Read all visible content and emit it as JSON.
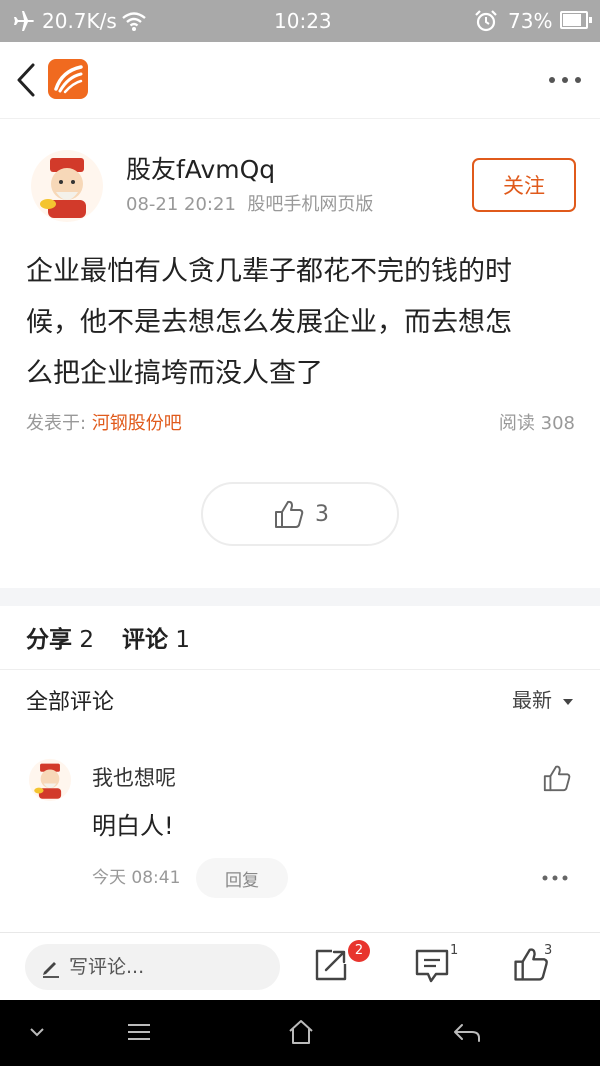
{
  "status_bar": {
    "speed": "20.7K/s",
    "time": "10:23",
    "battery": "73%"
  },
  "post": {
    "author": "股友fAvmQq",
    "meta": "08-21 20:21  股吧手机网页版",
    "follow_label": "关注",
    "content_lines": [
      "企业最怕有人贪几辈子都花不完的钱的时",
      "候，他不是去想怎么发展企业，而去想怎",
      "么把企业搞垮而没人查了"
    ],
    "posted_in_label": "发表于:",
    "forum": "河钢股份吧",
    "read_label": "阅读 308",
    "like_count": "3"
  },
  "tabs": {
    "share": "分享",
    "share_count": "2",
    "comment": "评论",
    "comment_count": "1"
  },
  "comments_header": {
    "title": "全部评论",
    "sort": "最新"
  },
  "comment": {
    "user": "我也想呢",
    "text": "明白人!",
    "time": "今天 08:41",
    "reply_label": "回复"
  },
  "bottom_bar": {
    "placeholder": "写评论...",
    "share_badge": "2",
    "comment_badge": "1",
    "like_badge": "3"
  },
  "colors": {
    "accent": "#e05a1b",
    "badge": "#e8352e",
    "status_bar": "#a9a9a9"
  }
}
